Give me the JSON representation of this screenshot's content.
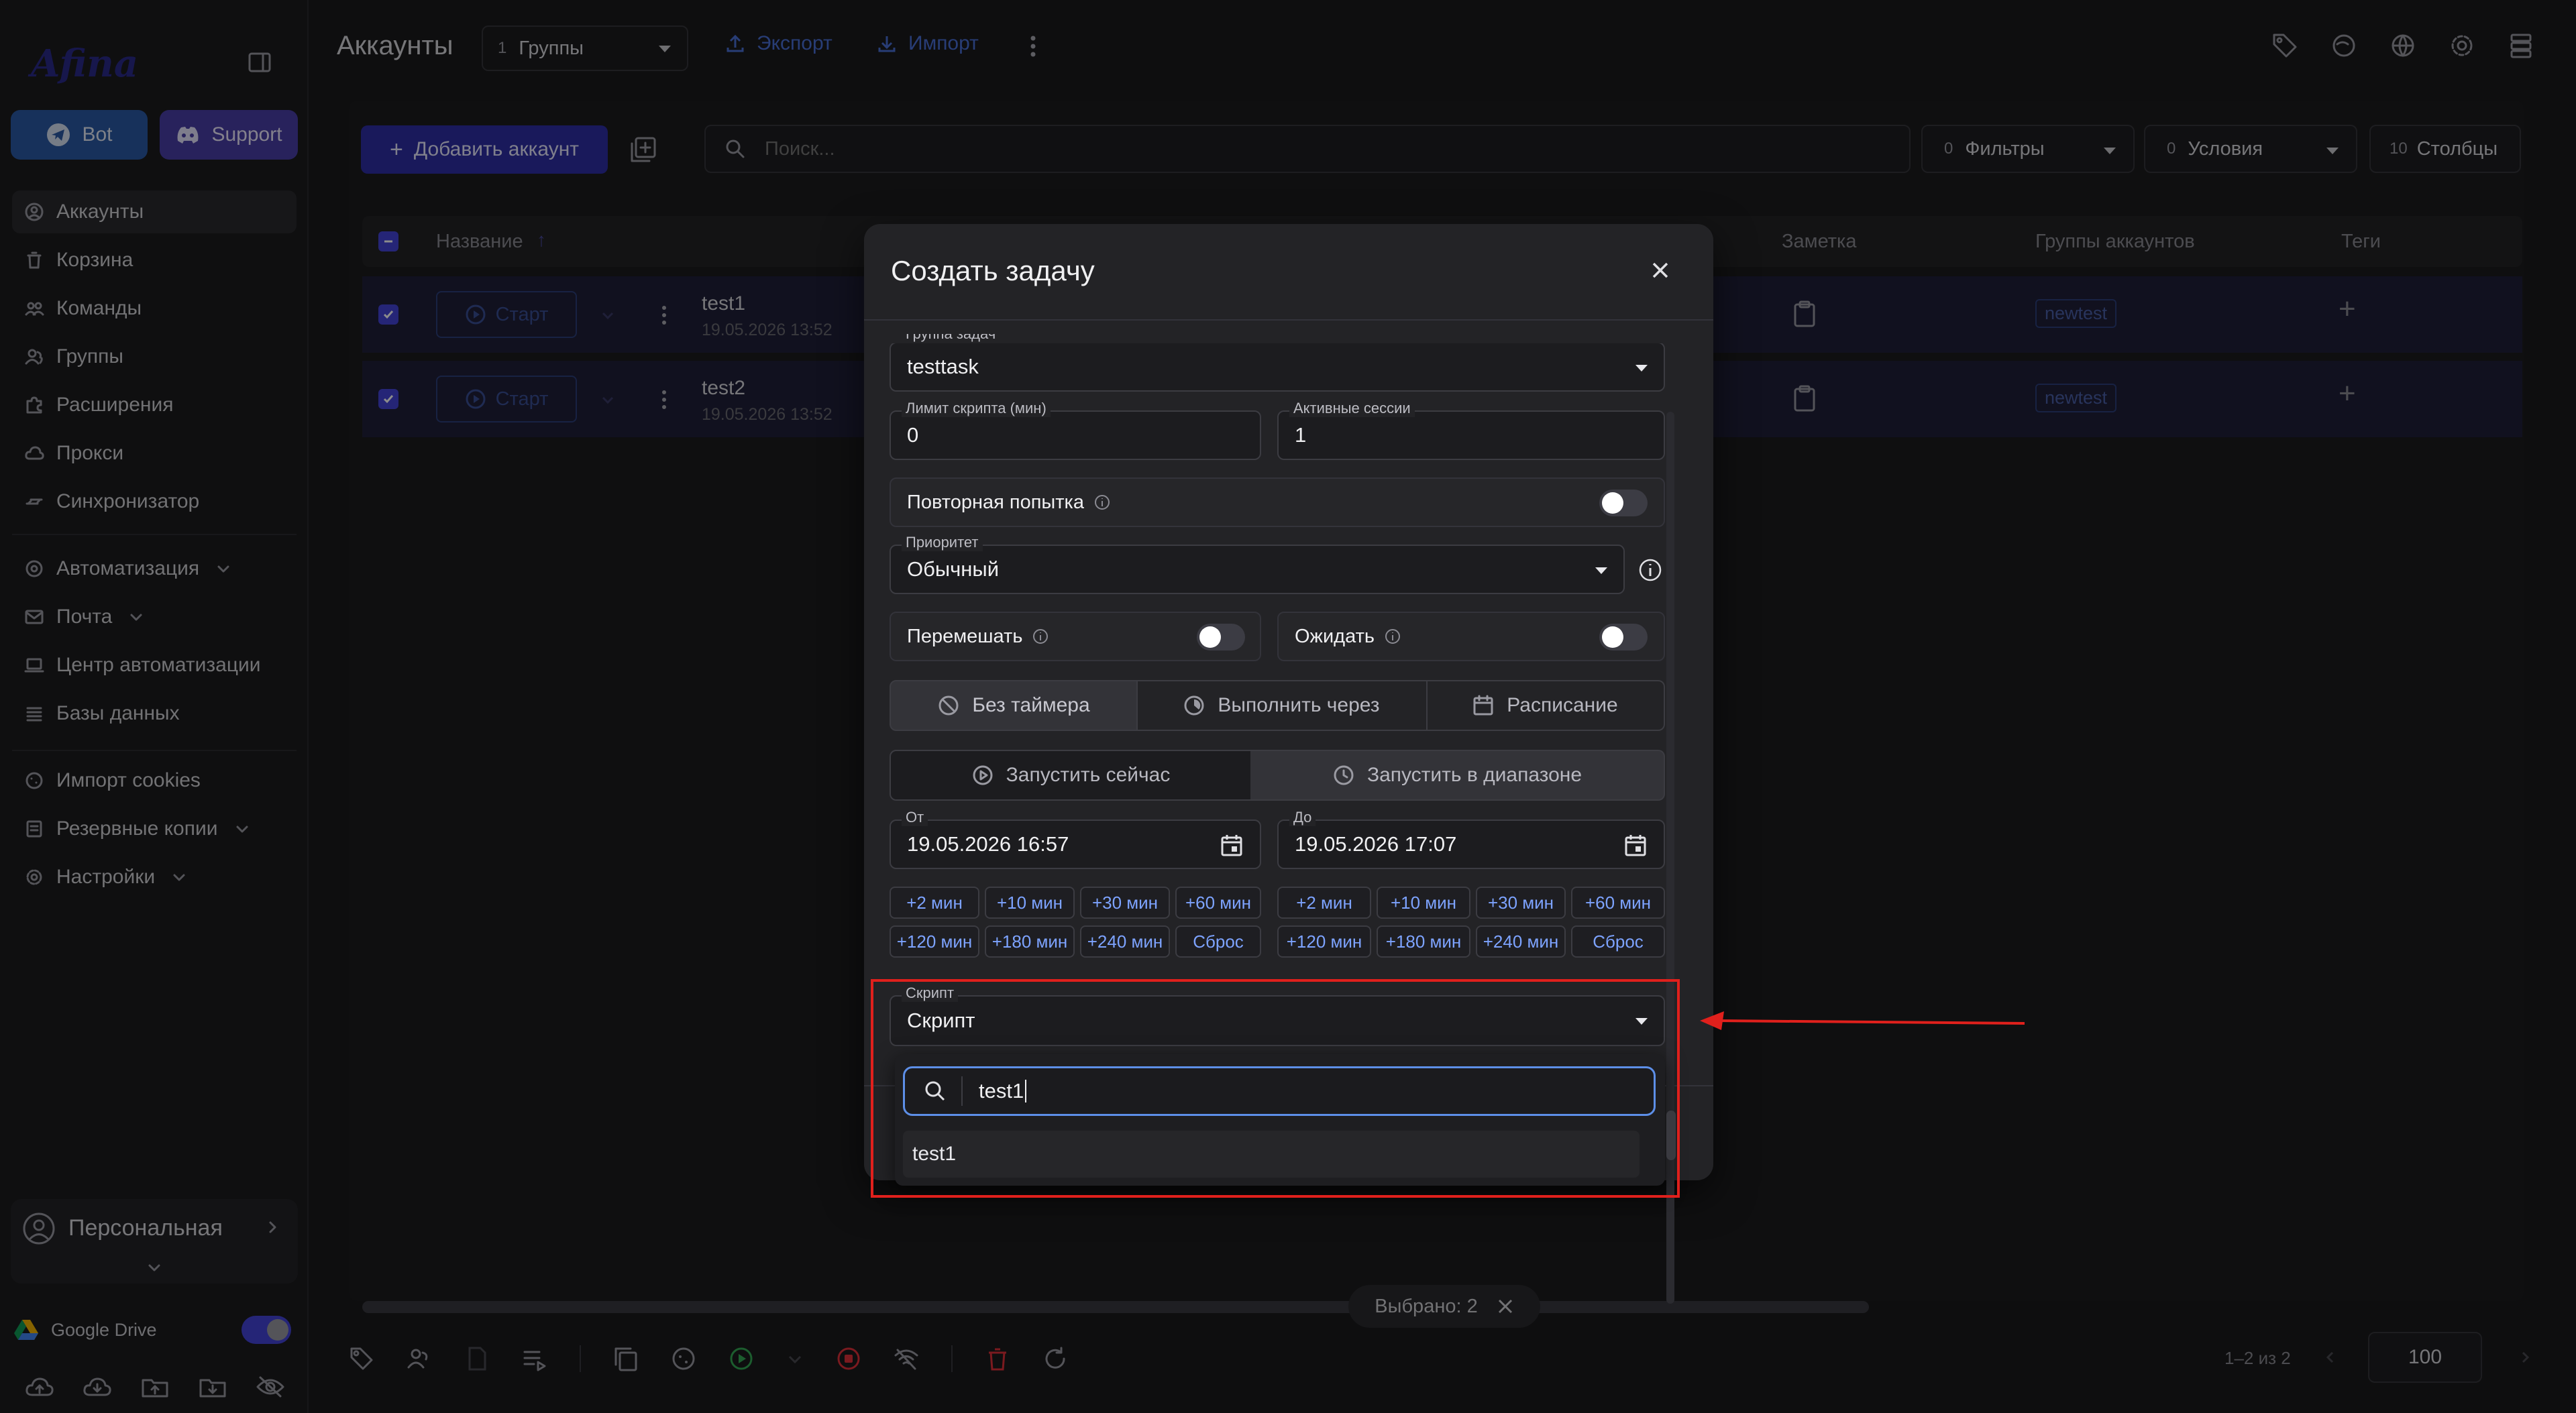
{
  "window": {
    "traffic": [
      "#fe5f57",
      "#febc2e",
      "#28c840"
    ]
  },
  "sidebar": {
    "logo": "Afina",
    "bot_label": "Bot",
    "support_label": "Support",
    "items": [
      {
        "label": "Аккаунты",
        "icon": "user-circle-icon"
      },
      {
        "label": "Корзина",
        "icon": "trash-icon"
      },
      {
        "label": "Команды",
        "icon": "team-icon"
      },
      {
        "label": "Группы",
        "icon": "users-icon"
      },
      {
        "label": "Расширения",
        "icon": "puzzle-icon"
      },
      {
        "label": "Прокси",
        "icon": "cloud-icon"
      },
      {
        "label": "Синхронизатор",
        "icon": "sync-icon"
      }
    ],
    "items2": [
      {
        "label": "Автоматизация",
        "icon": "robot-icon"
      },
      {
        "label": "Почта",
        "icon": "mail-icon"
      },
      {
        "label": "Центр автоматизации",
        "icon": "laptop-icon"
      },
      {
        "label": "Базы данных",
        "icon": "list-icon"
      }
    ],
    "items3": [
      {
        "label": "Импорт cookies",
        "icon": "cookie-icon"
      },
      {
        "label": "Резервные копии",
        "icon": "archive-icon"
      },
      {
        "label": "Настройки",
        "icon": "gear-icon"
      }
    ],
    "workspace_label": "Персональная",
    "google_drive_label": "Google Drive"
  },
  "header": {
    "title": "Аккаунты",
    "groups_count": "1",
    "groups_label": "Группы",
    "export_label": "Экспорт",
    "import_label": "Импорт"
  },
  "toolbar": {
    "add_account_label": "Добавить аккаунт",
    "search_placeholder": "Поиск...",
    "filters_count": "0",
    "filters_label": "Фильтры",
    "conditions_count": "0",
    "conditions_label": "Условия",
    "columns_count": "10",
    "columns_label": "Столбцы"
  },
  "table": {
    "columns": {
      "name": "Название",
      "sort": "↑",
      "note": "Заметка",
      "groups": "Группы аккаунтов",
      "tags": "Теги"
    },
    "rows": [
      {
        "start": "Старт",
        "name": "test1",
        "date": "19.05.2026 13:52",
        "group": "newtest"
      },
      {
        "start": "Старт",
        "name": "test2",
        "date": "19.05.2026 13:52",
        "group": "newtest"
      }
    ]
  },
  "bottom": {
    "selected_label": "Выбрано: 2",
    "pagination": "1–2 из 2",
    "page_size": "100"
  },
  "modal": {
    "title": "Создать задачу",
    "task_group_label": "Группа задач",
    "task_group_value": "testtask",
    "script_limit_label": "Лимит скрипта (мин)",
    "script_limit_value": "0",
    "active_sessions_label": "Активные сессии",
    "active_sessions_value": "1",
    "retry_label": "Повторная попытка",
    "priority_label": "Приоритет",
    "priority_value": "Обычный",
    "shuffle_label": "Перемешать",
    "wait_label": "Ожидать",
    "timer_tabs": [
      "Без таймера",
      "Выполнить через",
      "Расписание"
    ],
    "run_tabs": [
      "Запустить сейчас",
      "Запустить в диапазоне"
    ],
    "from_label": "От",
    "from_value": "19.05.2026 16:57",
    "to_label": "До",
    "to_value": "19.05.2026 17:07",
    "chips_row1": [
      "+2 мин",
      "+10 мин",
      "+30 мин",
      "+60 мин"
    ],
    "chips_row2": [
      "+120 мин",
      "+180 мин",
      "+240 мин",
      "Сброс"
    ],
    "script_label": "Скрипт",
    "script_value": "Скрипт",
    "script_search_value": "test1",
    "script_option": "test1"
  },
  "colors": {
    "accent": "#2f2fa6",
    "highlight": "#e0201c",
    "link": "#4a6fd8"
  }
}
